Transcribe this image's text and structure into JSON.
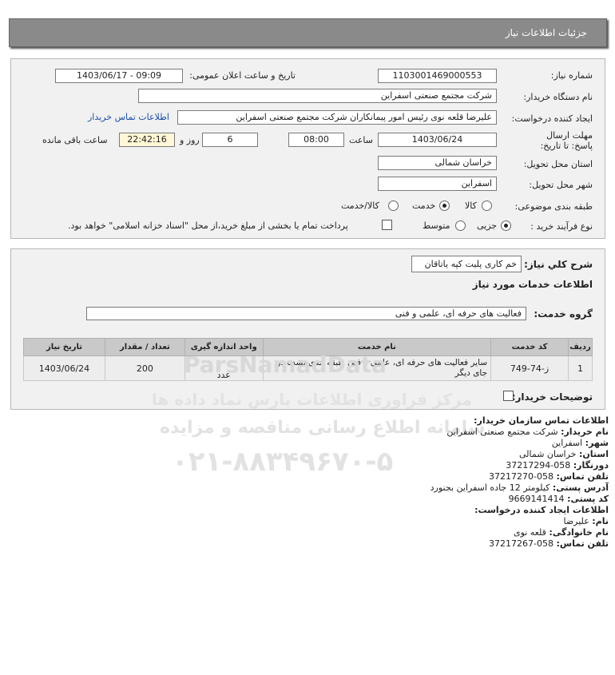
{
  "header": {
    "title": "جزئیات اطلاعات نیاز"
  },
  "form": {
    "need_number_label": "شماره نیاز:",
    "need_number": "1103001469000553",
    "announce_label": "تاریخ و ساعت اعلان عمومی:",
    "announce_value": "1403/06/17 - 09:09",
    "buyer_name_label": "نام دستگاه خریدار:",
    "buyer_name": "شرکت مجتمع صنعتی اسفراین",
    "creator_label": "ایجاد کننده درخواست:",
    "creator": "علیرضا قلعه نوی رئیس امور پیمانکاران شرکت مجتمع صنعتی اسفراین",
    "contact_link": "اطلاعات تماس خریدار",
    "deadline_label": "مهلت ارسال پاسخ: تا تاریخ:",
    "deadline_date": "1403/06/24",
    "time_label": "ساعت",
    "deadline_time": "08:00",
    "days_value": "6",
    "days_label": "روز و",
    "remaining_time": "22:42:16",
    "remaining_label": "ساعت باقی مانده",
    "province_label": "استان محل تحویل:",
    "province": "خراسان شمالی",
    "city_label": "شهر محل تحویل:",
    "city": "اسفراین",
    "category_label": "طبقه بندی موضوعی:",
    "category_options": [
      "کالا",
      "خدمت",
      "کالا/خدمت"
    ],
    "category_selected": "خدمت",
    "purchase_type_label": "نوع فرآیند خرید :",
    "purchase_options": [
      "جزیی",
      "متوسط"
    ],
    "purchase_selected": "جزیی",
    "treasury_note": "پرداخت تمام یا بخشی از مبلغ خرید،از محل \"اسناد خزانه اسلامی\" خواهد بود."
  },
  "details": {
    "summary_label": "شرح كلي نياز:",
    "summary_value": "خم کاری پلیت کپه یاتاقان",
    "services_heading": "اطلاعات خدمات مورد نياز",
    "group_label": "گروه خدمت:",
    "group_value": "فعالیت های حرفه ای، علمی و فنی",
    "table": {
      "headers": [
        "ردیف",
        "کد خدمت",
        "نام خدمت",
        "واحد اندازه گیری",
        "تعداد / مقدار",
        "تاریخ نیاز"
      ],
      "rows": [
        [
          "1",
          "ز-74-749",
          "سایر فعالیت های حرفه ای، علمی و فنی طبقه بندی نشده در جای دیگر",
          "عدد",
          "200",
          "1403/06/24"
        ]
      ]
    },
    "buyer_notes_label": "توضیحات خریدار:"
  },
  "contact": {
    "heading": "اطلاعات تماس سازمان خریدار:",
    "org_label": "نام خریدار:",
    "org_value": "شرکت مجتمع صنعتی اسفراین",
    "city_label": "شهر:",
    "city_value": "اسفراین",
    "province_label": "استان:",
    "province_value": "خراسان شمالی",
    "fax_label": "دورنگار:",
    "fax_value": "058-37217294",
    "phone_label": "تلفن تماس:",
    "phone_value": "058-37217270",
    "address_label": "آدرس پستی:",
    "address_value": "کیلومتر 12 جاده اسفراین بجنورد",
    "postal_label": "کد پستی:",
    "postal_value": "9669141414",
    "creator_heading": "اطلاعات ایجاد کننده درخواست:",
    "first_name_label": "نام:",
    "first_name_value": "علیرضا",
    "last_name_label": "نام خانوادگی:",
    "last_name_value": "قلعه نوی",
    "creator_phone_label": "تلفن تماس:",
    "creator_phone_value": "058-37217267"
  },
  "watermark": {
    "line1": "ParsNamadData",
    "line2": "مرکز فراوری اطلاعات پارس نماد داده ها",
    "line3": "سامانه اطلاع رسانی مناقصه و مزایده",
    "line4": "۰۲۱-۸۸۳۴۹۶۷۰-۵"
  }
}
